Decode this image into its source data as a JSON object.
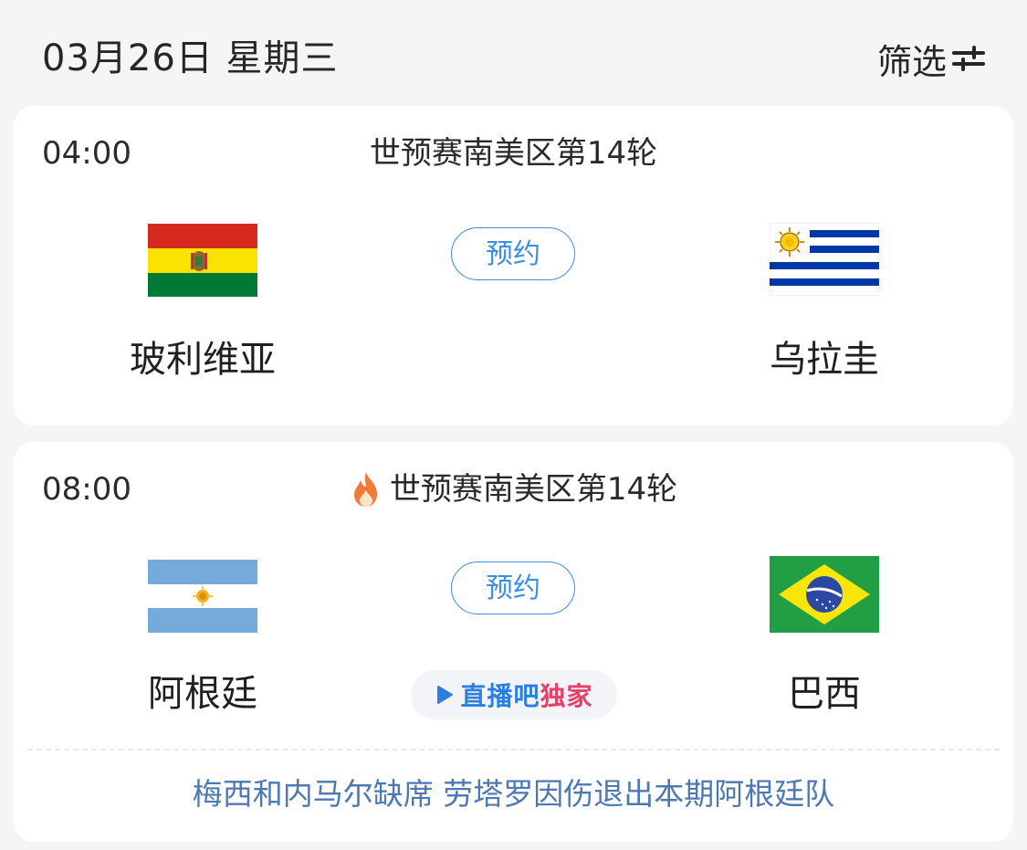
{
  "header": {
    "date": "03月26日 星期三",
    "filter_label": "筛选",
    "filter_icon": "sliders-icon"
  },
  "matches": [
    {
      "time": "04:00",
      "round": "世预赛南美区第14轮",
      "hot": false,
      "home": {
        "name": "玻利维亚",
        "flag": "bolivia-flag"
      },
      "away": {
        "name": "乌拉圭",
        "flag": "uruguay-flag"
      },
      "action_label": "预约"
    },
    {
      "time": "08:00",
      "round": "世预赛南美区第14轮",
      "hot": true,
      "hot_icon": "fire-icon",
      "home": {
        "name": "阿根廷",
        "flag": "argentina-flag"
      },
      "away": {
        "name": "巴西",
        "flag": "brazil-flag"
      },
      "action_label": "预约",
      "live_badge": {
        "text": "直播吧",
        "exclusive": "独家",
        "icon": "play-icon"
      },
      "news": "梅西和内马尔缺席 劳塔罗因伤退出本期阿根廷队"
    }
  ],
  "colors": {
    "background": "#f4f5f7",
    "card": "#ffffff",
    "accent_blue": "#3a8ee6",
    "news_blue": "#4d79b3",
    "exclusive_red": "#e4406a"
  }
}
